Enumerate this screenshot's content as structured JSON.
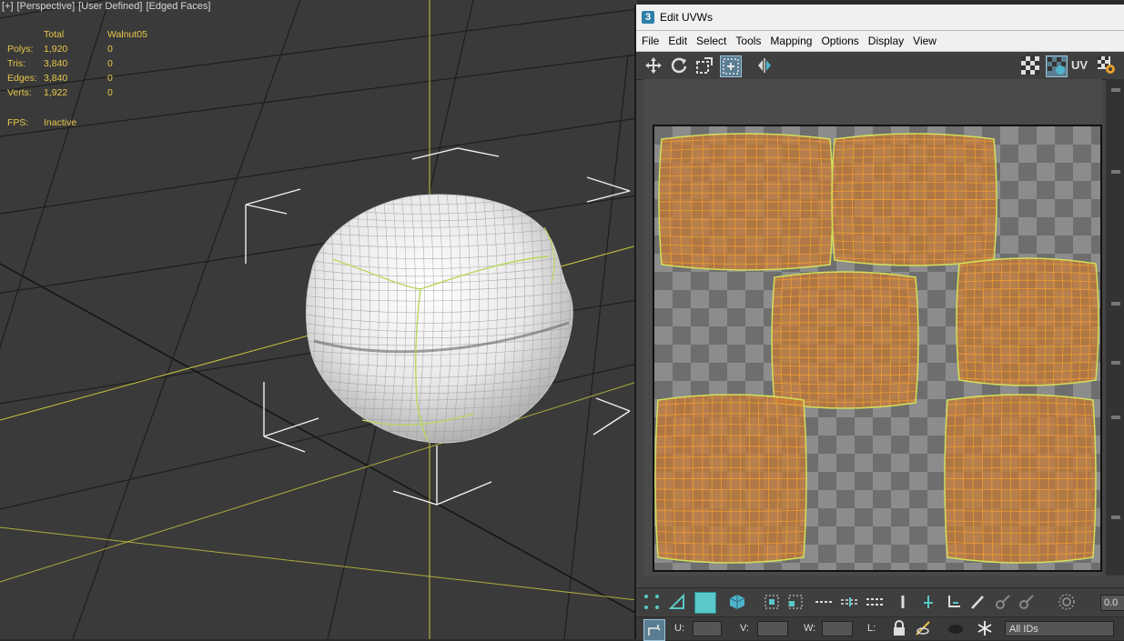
{
  "viewport": {
    "label_parts": [
      "[+]",
      "[Perspective]",
      "[User Defined]",
      "[Edged Faces]"
    ],
    "stats": {
      "header_total": "Total",
      "header_object": "Walnut05",
      "rows": [
        {
          "label": "Polys:",
          "total": "1,920",
          "object": "0"
        },
        {
          "label": "Tris:",
          "total": "3,840",
          "object": "0"
        },
        {
          "label": "Edges:",
          "total": "3,840",
          "object": "0"
        },
        {
          "label": "Verts:",
          "total": "1,922",
          "object": "0"
        }
      ]
    },
    "fps_label": "FPS:",
    "fps_value": "Inactive",
    "grid_color": "#1e1e1e",
    "axis_color": "#c8c83c"
  },
  "uvw": {
    "app_icon": "3",
    "title": "Edit UVWs",
    "menu": [
      "File",
      "Edit",
      "Select",
      "Tools",
      "Mapping",
      "Options",
      "Display",
      "View"
    ],
    "uv_label": "UV",
    "fields": {
      "u_label": "U:",
      "v_label": "V:",
      "w_label": "W:",
      "l_label": "L:",
      "spinner_value": "0.0",
      "ids_value": "All IDs"
    },
    "icons": {
      "move": "move-icon",
      "rotate": "rotate-icon",
      "scale": "scale-icon",
      "freeform": "freeform-icon",
      "mirror": "mirror-icon",
      "checker": "checker-pattern-icon",
      "uv_view": "uv-view-icon",
      "settings": "settings-icon"
    },
    "shell_color": "#c57a3a",
    "shell_edge_color": "#e69a35",
    "shell_border_color": "#d2e05a"
  }
}
